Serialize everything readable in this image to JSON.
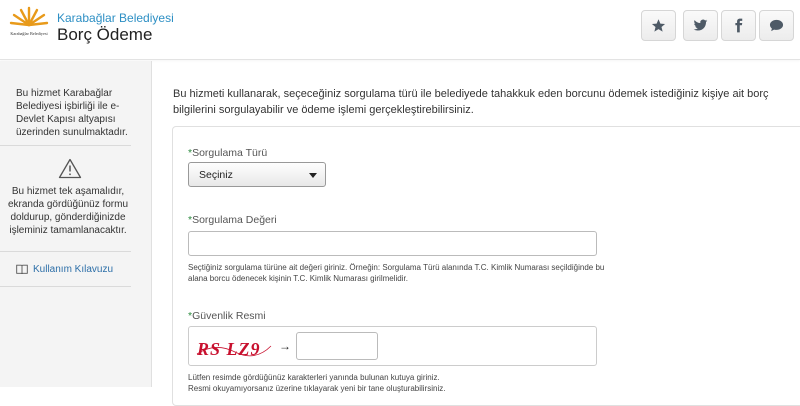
{
  "header": {
    "institution": "Karabağlar Belediyesi",
    "logo_text": "Karabağlar Belediyesi",
    "title": "Borç Ödeme",
    "buttons": [
      {
        "name": "favorite-button",
        "icon": "star-icon"
      },
      {
        "name": "twitter-button",
        "icon": "twitter-icon"
      },
      {
        "name": "facebook-button",
        "icon": "facebook-icon"
      },
      {
        "name": "comment-button",
        "icon": "comment-icon"
      }
    ]
  },
  "sidebar": {
    "info": "Bu hizmet Karabağlar Belediyesi işbirliği ile e-Devlet Kapısı altyapısı üzerinden sunulmaktadır.",
    "warning_icon": "warning-triangle-icon",
    "warning": "Bu hizmet tek aşamalıdır, ekranda gördüğünüz formu doldurup, gönderdiğinizde işleminiz tamamlanacaktır.",
    "guide_icon": "book-icon",
    "guide_link": "Kullanım Kılavuzu"
  },
  "main": {
    "intro": "Bu hizmeti kullanarak, seçeceğiniz sorgulama türü ile belediyede tahakkuk eden borcunu ödemek istediğiniz kişiye ait borç bilgilerini sorgulayabilir ve ödeme işlemi gerçekleştirebilirsiniz.",
    "required_mark": "*",
    "query_type": {
      "label": "Sorgulama Türü",
      "selected": "Seçiniz"
    },
    "query_value": {
      "label": "Sorgulama Değeri",
      "value": "",
      "help": "Seçtiğiniz sorgulama türüne ait değeri giriniz. Örneğin: Sorgulama Türü alanında T.C. Kimlik Numarası seçildiğinde bu alana borcu ödenecek kişinin T.C. Kimlik Numarası girilmelidir."
    },
    "captcha": {
      "label": "Güvenlik Resmi",
      "image_text": "RS LZ9",
      "arrow": "→",
      "value": "",
      "help": "Lütfen resimde gördüğünüz karakterleri yanında bulunan kutuya giriniz.",
      "help2": "Resmi okuyamıyorsanız üzerine tıklayarak yeni bir tane oluşturabilirsiniz."
    }
  },
  "colors": {
    "accent_link": "#2d8fc4",
    "required": "#2b8a3e",
    "captcha_red": "#c8102e"
  }
}
